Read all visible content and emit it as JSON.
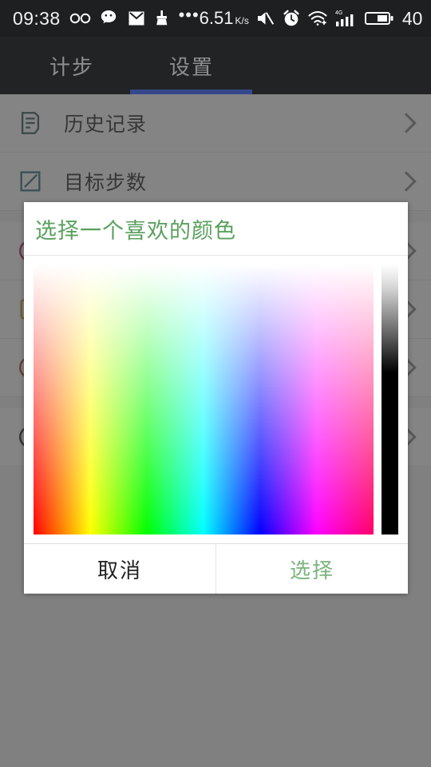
{
  "statusbar": {
    "clock": "09:38",
    "left_icons": [
      "infinity-icon",
      "wechat-icon",
      "mail-icon",
      "broom-icon",
      "more-dots-icon"
    ],
    "net_rate": "6.51",
    "net_rate_unit": "K/s",
    "right_icons": [
      "mute-icon",
      "alarm-icon",
      "wifi-icon",
      "signal-4g-icon",
      "battery-icon"
    ],
    "battery_percent": "40",
    "signal_badge": "4G",
    "bg_color": "#1e1f21"
  },
  "tabs": {
    "items": [
      {
        "label": "计步",
        "active": false
      },
      {
        "label": "设置",
        "active": true
      }
    ],
    "active_index": 1,
    "indicator_color": "#35488c",
    "inactive_color": "#8d8f92"
  },
  "settings_list": {
    "rows": [
      {
        "label": "历史记录",
        "icon": "note-icon",
        "icon_color": "#3b5a60"
      },
      {
        "label": "目标步数",
        "icon": "edit-square-icon",
        "icon_color": "#2a6f78"
      },
      {
        "label": "",
        "icon": "circle-icon",
        "icon_color": "#b0286a"
      },
      {
        "label": "",
        "icon": "square-icon",
        "icon_color": "#c79a2a"
      },
      {
        "label": "",
        "icon": "circle-icon",
        "icon_color": "#b04a2a"
      },
      {
        "label": "",
        "icon": "circle-icon",
        "icon_color": "#2b2b2b"
      }
    ],
    "chevron_icon": "chevron-right-icon"
  },
  "dialog": {
    "title": "选择一个喜欢的颜色",
    "title_color": "#5aa05e",
    "picker": {
      "type": "hsv-color-picker",
      "saturation_value_panel": "hue-horizontal-white-vertical",
      "value_strip": "white-to-black"
    },
    "buttons": {
      "cancel": "取消",
      "confirm": "选择",
      "confirm_color": "#7bb47e"
    }
  }
}
